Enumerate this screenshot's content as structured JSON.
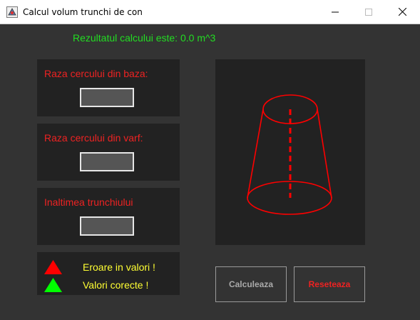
{
  "window": {
    "title": "Calcul volum trunchi de con",
    "controls": {
      "minimize": "minimize-icon",
      "maximize": "maximize-icon",
      "close": "close-icon"
    }
  },
  "result": {
    "text": "Rezultatul calcului este: 0.0 m^3",
    "color": "#22dd22"
  },
  "inputs": [
    {
      "label": "Raza cercului din baza:",
      "value": ""
    },
    {
      "label": "Raza cercului din varf:",
      "value": ""
    },
    {
      "label": "Inaltimea trunchiului",
      "value": ""
    }
  ],
  "legend": [
    {
      "text": "Eroare in valori !",
      "icon": "red-triangle-icon",
      "color": "#ff0000"
    },
    {
      "text": "Valori corecte !",
      "icon": "green-triangle-icon",
      "color": "#00ff00"
    }
  ],
  "buttons": {
    "calculate": {
      "label": "Calculeaza",
      "color": "#aaaaaa"
    },
    "reset": {
      "label": "Reseteaza",
      "color": "#ee2222"
    }
  },
  "colors": {
    "background": "#333333",
    "panel": "#222222",
    "label": "#ee2222",
    "legend_text": "#ffff33",
    "drawing_stroke": "#ff0000"
  }
}
